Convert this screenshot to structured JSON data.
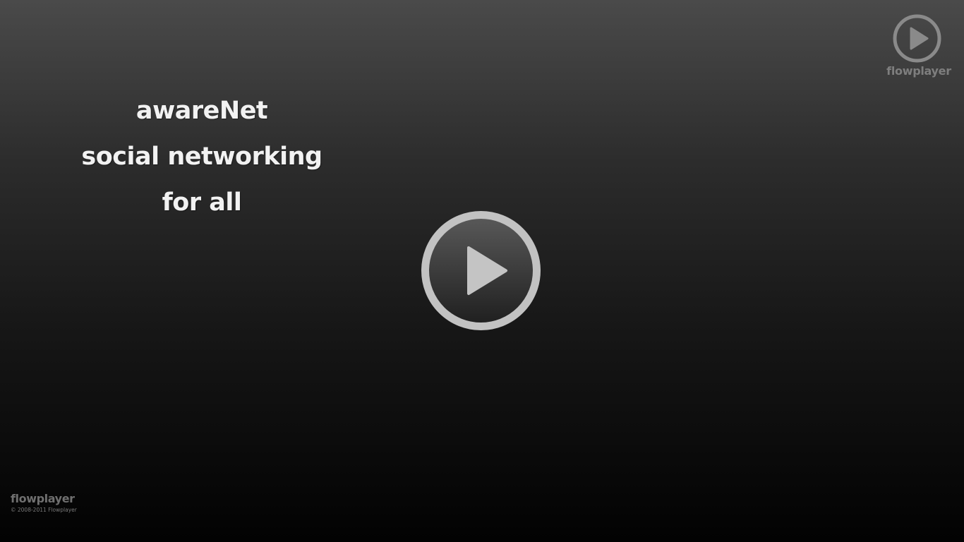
{
  "video": {
    "title_lines": [
      "awareNet",
      "social networking",
      "for all"
    ]
  },
  "controls": {
    "play_icon": "play-icon"
  },
  "branding": {
    "logo_icon": "play-circle-icon",
    "logo_text": "flowplayer",
    "footer_name": "flowplayer",
    "copyright": "© 2008-2011 Flowplayer"
  },
  "colors": {
    "gradient_top": "#4a4a4a",
    "gradient_bottom": "#020202",
    "title_text": "#f2f2f2",
    "play_ring": "#c2c2c2",
    "play_triangle": "#c4c4c4",
    "logo": "#8a8a8a"
  }
}
